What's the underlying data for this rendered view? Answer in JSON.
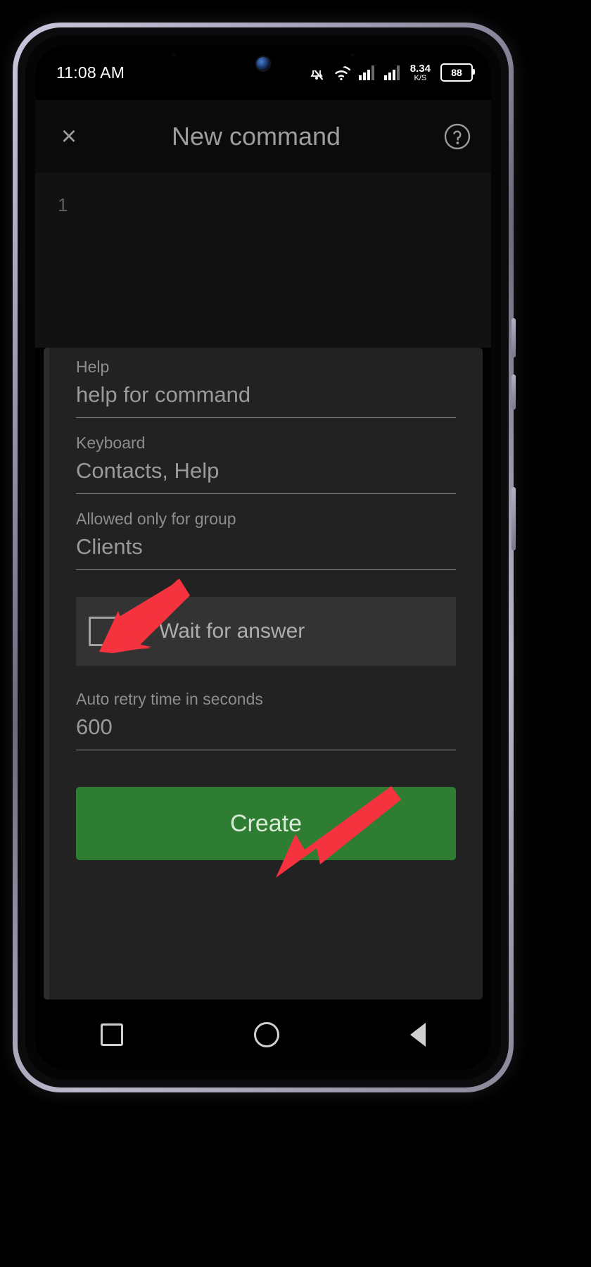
{
  "status_bar": {
    "time": "11:08 AM",
    "icons": [
      "notifications-silenced-icon",
      "wifi-icon",
      "signal-sim1-icon",
      "signal-sim2-icon"
    ],
    "network_speed_value": "8.34",
    "network_speed_unit": "K/S",
    "battery_level": "88"
  },
  "app_header": {
    "close_label": "×",
    "title": "New command",
    "help_icon": "help-circle-icon"
  },
  "editor": {
    "line_number": "1",
    "content": ""
  },
  "form": {
    "fields": [
      {
        "label": "Help",
        "value": "help for command"
      },
      {
        "label": "Keyboard",
        "value": "Contacts, Help"
      },
      {
        "label": "Allowed only for group",
        "value": "Clients"
      }
    ],
    "checkbox": {
      "label": "Wait for answer",
      "checked": false
    },
    "retry_field": {
      "label": "Auto retry time in seconds",
      "value": "600"
    },
    "submit_label": "Create"
  },
  "nav_bar": {
    "recents": "recents-square-icon",
    "home": "home-circle-icon",
    "back": "back-triangle-icon"
  },
  "annotations": {
    "arrow_color": "#F5333F",
    "arrows": [
      {
        "name": "arrow-pointing-to-wait-for-answer",
        "target": "Wait for answer checkbox"
      },
      {
        "name": "arrow-pointing-to-create-button",
        "target": "Create button"
      }
    ]
  },
  "colors": {
    "accent_green": "#2F7D32",
    "sheet_background": "#222222",
    "header_background": "#0B0B0B",
    "editor_background": "#121212",
    "arrow_red": "#F5333F"
  }
}
